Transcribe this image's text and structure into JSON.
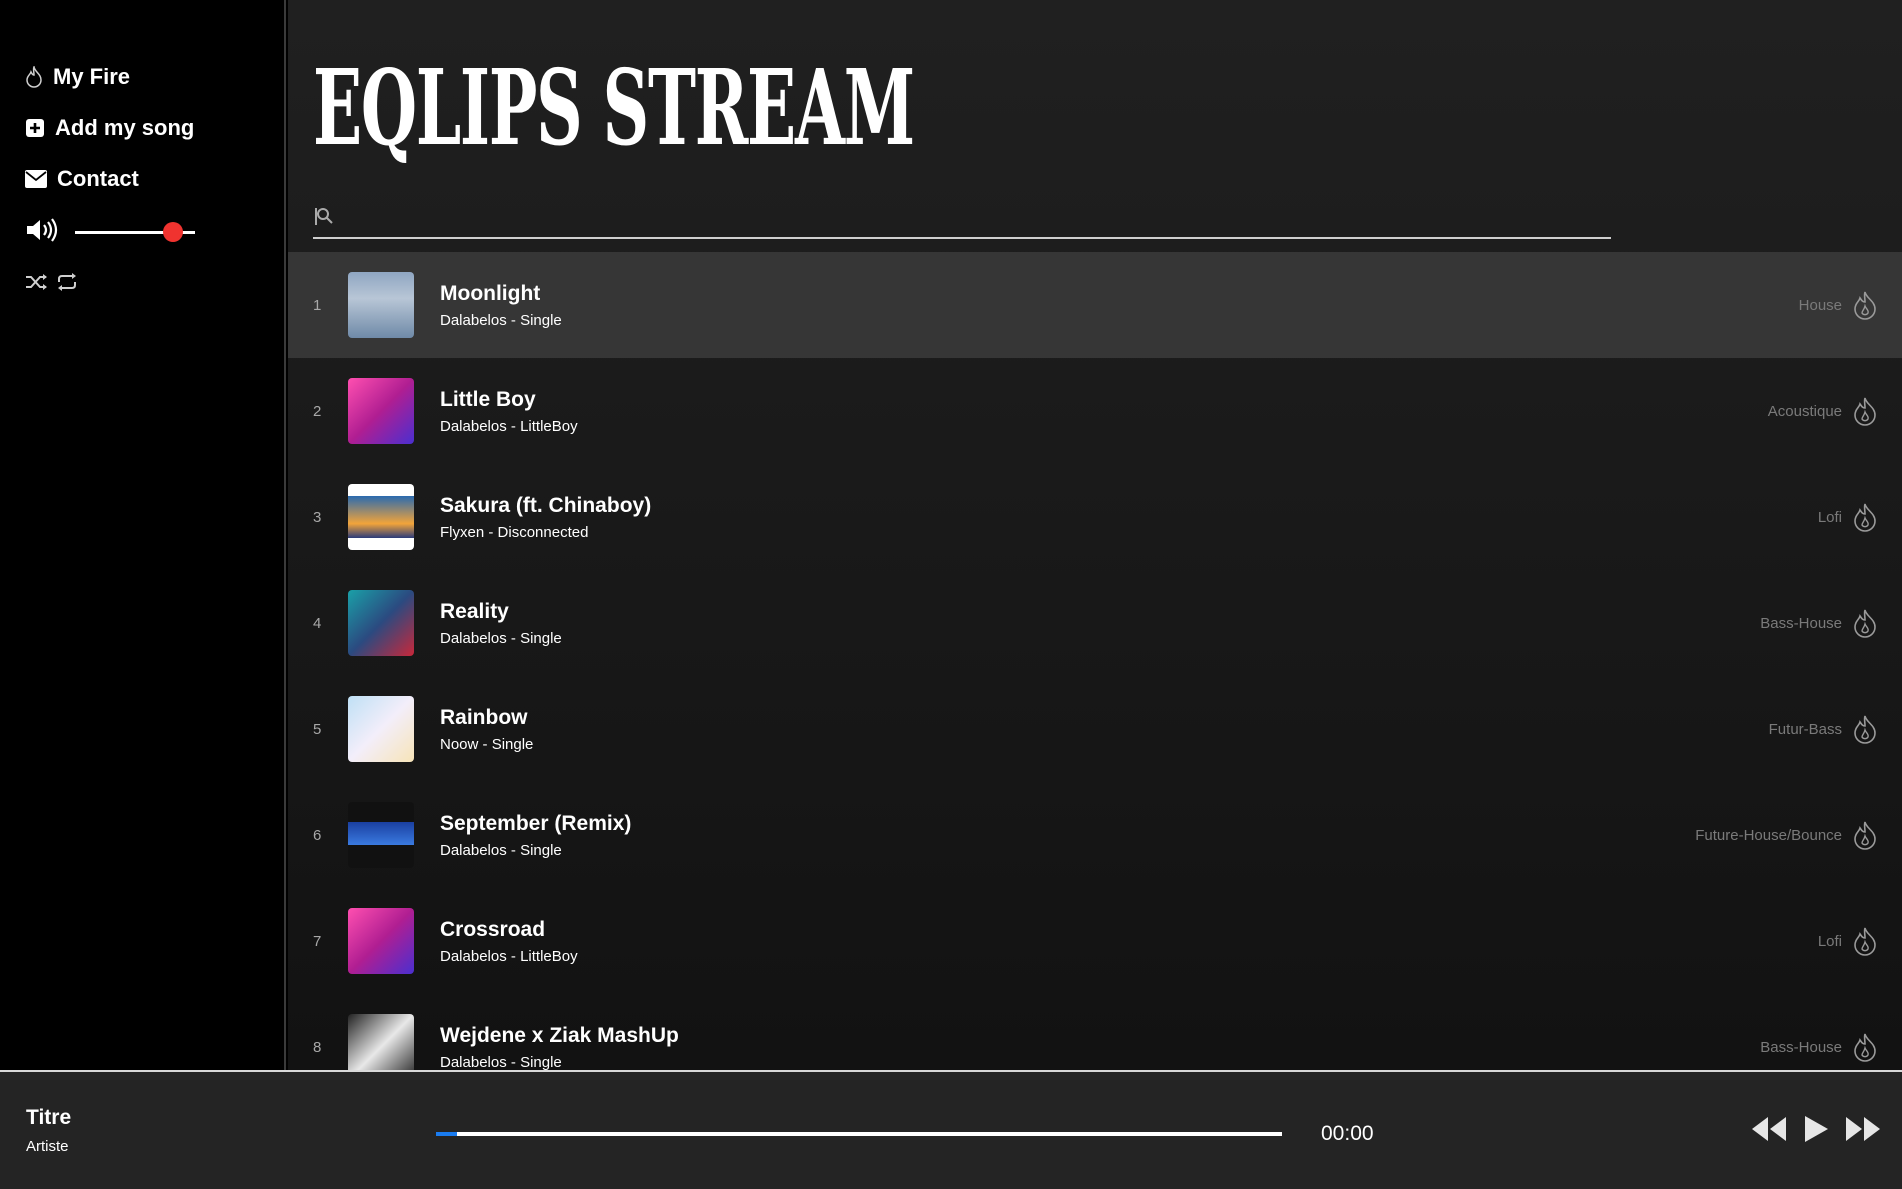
{
  "app": {
    "brand": "EQLIPS STREAM"
  },
  "sidebar": {
    "items": [
      {
        "label": "My Fire",
        "icon": "fire-icon"
      },
      {
        "label": "Add my song",
        "icon": "plus-square-icon"
      },
      {
        "label": "Contact",
        "icon": "envelope-icon"
      }
    ],
    "volume": {
      "level": 0.82,
      "icon": "speaker-icon",
      "accent": "#f0332f"
    },
    "playback_modes": [
      "shuffle-icon",
      "repeat-icon"
    ]
  },
  "search": {
    "placeholder": "",
    "value": "",
    "icon": "search-icon"
  },
  "tracks": [
    {
      "index": "1",
      "title": "Moonlight",
      "artist": "Dalabelos",
      "album": "Single",
      "genre": "House",
      "active": true
    },
    {
      "index": "2",
      "title": "Little Boy",
      "artist": "Dalabelos",
      "album": "LittleBoy",
      "genre": "Acoustique"
    },
    {
      "index": "3",
      "title": "Sakura (ft. Chinaboy)",
      "artist": "Flyxen",
      "album": "Disconnected",
      "genre": "Lofi"
    },
    {
      "index": "4",
      "title": "Reality",
      "artist": "Dalabelos",
      "album": "Single",
      "genre": "Bass-House"
    },
    {
      "index": "5",
      "title": "Rainbow",
      "artist": "Noow",
      "album": "Single",
      "genre": "Futur-Bass"
    },
    {
      "index": "6",
      "title": "September (Remix)",
      "artist": "Dalabelos",
      "album": "Single",
      "genre": "Future-House/Bounce"
    },
    {
      "index": "7",
      "title": "Crossroad",
      "artist": "Dalabelos",
      "album": "LittleBoy",
      "genre": "Lofi"
    },
    {
      "index": "8",
      "title": "Wejdene x Ziak MashUp",
      "artist": "Dalabelos",
      "album": "Single",
      "genre": "Bass-House"
    }
  ],
  "player": {
    "title": "Titre",
    "artist": "Artiste",
    "time": "00:00",
    "progress": 0.025,
    "progress_color": "#1a7cf0",
    "controls": [
      "rewind-icon",
      "play-icon",
      "fast-forward-icon"
    ]
  }
}
